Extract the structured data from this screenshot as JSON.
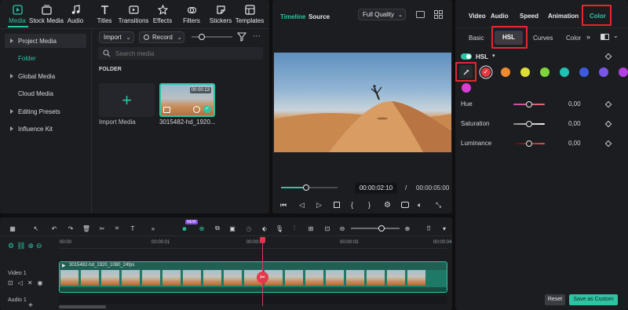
{
  "toolbar": {
    "items": [
      {
        "label": "Media",
        "icon": "media-icon",
        "active": true
      },
      {
        "label": "Stock Media",
        "icon": "stock-media-icon"
      },
      {
        "label": "Audio",
        "icon": "audio-icon"
      },
      {
        "label": "Titles",
        "icon": "titles-icon"
      },
      {
        "label": "Transitions",
        "icon": "transitions-icon"
      },
      {
        "label": "Effects",
        "icon": "effects-icon"
      },
      {
        "label": "Filters",
        "icon": "filters-icon"
      },
      {
        "label": "Stickers",
        "icon": "stickers-icon"
      },
      {
        "label": "Templates",
        "icon": "templates-icon"
      }
    ]
  },
  "sidebar": {
    "items": [
      {
        "label": "Project Media",
        "expandable": true
      },
      {
        "label": "Folder",
        "active": true
      },
      {
        "label": "Global Media",
        "expandable": true
      },
      {
        "label": "Cloud Media"
      },
      {
        "label": "Editing Presets",
        "expandable": true
      },
      {
        "label": "Influence Kit",
        "expandable": true
      }
    ]
  },
  "media": {
    "import_label": "Import",
    "record_label": "Record",
    "search_placeholder": "Search media",
    "folder_heading": "FOLDER",
    "import_tile_label": "Import Media",
    "clip_name": "3015482-hd_1920...",
    "clip_duration": "00:00:13"
  },
  "player": {
    "tab_timeline": "Timeline",
    "tab_source": "Source",
    "quality": "Full Quality",
    "current_time": "00:00:02:10",
    "separator": "/",
    "total_time": "00:00:05:00",
    "progress": 0.45
  },
  "inspector": {
    "top_tabs": [
      "Video",
      "Audio",
      "Speed",
      "Animation",
      "Color"
    ],
    "sub_tabs": [
      "Basic",
      "HSL",
      "Curves",
      "Color"
    ],
    "hsl_label": "HSL",
    "swatches": [
      "#e23a3f",
      "#ef8a2e",
      "#dede36",
      "#7fd43a",
      "#1fc3b3",
      "#3c5be0",
      "#7a56e6",
      "#b43fe0",
      "#d640d2"
    ],
    "sliders": [
      {
        "label": "Hue",
        "value": "0,00",
        "gradient": "linear-gradient(90deg,#c94da9,#e06b6b)"
      },
      {
        "label": "Saturation",
        "value": "0,00",
        "gradient": "linear-gradient(90deg,#8a8a8a,#f0f0f0)"
      },
      {
        "label": "Luminance",
        "value": "0,00",
        "gradient": "linear-gradient(90deg,#3a0d0d,#e35151)"
      }
    ],
    "reset_label": "Reset",
    "save_label": "Save as Custom"
  },
  "timeline": {
    "ruler": [
      "00:00",
      "00:00:01",
      "00:00:02",
      "00:00:03",
      "00:00:04"
    ],
    "track_video_label": "Video 1",
    "track_audio_label": "Audio 1",
    "clip_label": "3015482-hd_1920_1080_24fps",
    "badge": "NEW"
  },
  "colors": {
    "accent": "#2ec4a3",
    "highlight": "#e0292f",
    "panel": "#1c1d21"
  }
}
